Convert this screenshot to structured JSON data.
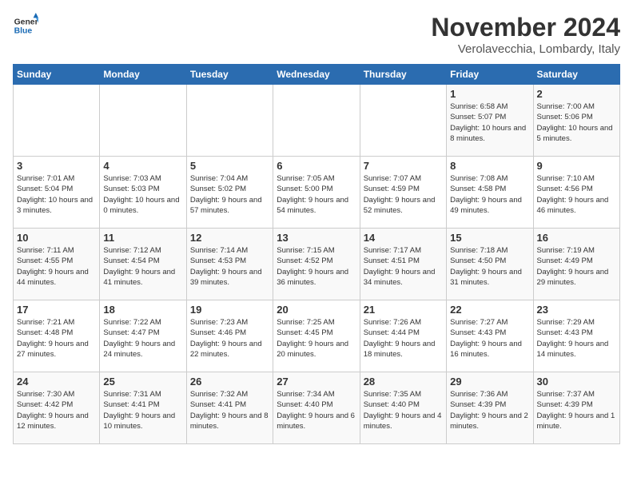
{
  "logo": {
    "general": "General",
    "blue": "Blue"
  },
  "title": "November 2024",
  "subtitle": "Verolavecchia, Lombardy, Italy",
  "headers": [
    "Sunday",
    "Monday",
    "Tuesday",
    "Wednesday",
    "Thursday",
    "Friday",
    "Saturday"
  ],
  "weeks": [
    [
      {
        "day": "",
        "info": ""
      },
      {
        "day": "",
        "info": ""
      },
      {
        "day": "",
        "info": ""
      },
      {
        "day": "",
        "info": ""
      },
      {
        "day": "",
        "info": ""
      },
      {
        "day": "1",
        "info": "Sunrise: 6:58 AM\nSunset: 5:07 PM\nDaylight: 10 hours and 8 minutes."
      },
      {
        "day": "2",
        "info": "Sunrise: 7:00 AM\nSunset: 5:06 PM\nDaylight: 10 hours and 5 minutes."
      }
    ],
    [
      {
        "day": "3",
        "info": "Sunrise: 7:01 AM\nSunset: 5:04 PM\nDaylight: 10 hours and 3 minutes."
      },
      {
        "day": "4",
        "info": "Sunrise: 7:03 AM\nSunset: 5:03 PM\nDaylight: 10 hours and 0 minutes."
      },
      {
        "day": "5",
        "info": "Sunrise: 7:04 AM\nSunset: 5:02 PM\nDaylight: 9 hours and 57 minutes."
      },
      {
        "day": "6",
        "info": "Sunrise: 7:05 AM\nSunset: 5:00 PM\nDaylight: 9 hours and 54 minutes."
      },
      {
        "day": "7",
        "info": "Sunrise: 7:07 AM\nSunset: 4:59 PM\nDaylight: 9 hours and 52 minutes."
      },
      {
        "day": "8",
        "info": "Sunrise: 7:08 AM\nSunset: 4:58 PM\nDaylight: 9 hours and 49 minutes."
      },
      {
        "day": "9",
        "info": "Sunrise: 7:10 AM\nSunset: 4:56 PM\nDaylight: 9 hours and 46 minutes."
      }
    ],
    [
      {
        "day": "10",
        "info": "Sunrise: 7:11 AM\nSunset: 4:55 PM\nDaylight: 9 hours and 44 minutes."
      },
      {
        "day": "11",
        "info": "Sunrise: 7:12 AM\nSunset: 4:54 PM\nDaylight: 9 hours and 41 minutes."
      },
      {
        "day": "12",
        "info": "Sunrise: 7:14 AM\nSunset: 4:53 PM\nDaylight: 9 hours and 39 minutes."
      },
      {
        "day": "13",
        "info": "Sunrise: 7:15 AM\nSunset: 4:52 PM\nDaylight: 9 hours and 36 minutes."
      },
      {
        "day": "14",
        "info": "Sunrise: 7:17 AM\nSunset: 4:51 PM\nDaylight: 9 hours and 34 minutes."
      },
      {
        "day": "15",
        "info": "Sunrise: 7:18 AM\nSunset: 4:50 PM\nDaylight: 9 hours and 31 minutes."
      },
      {
        "day": "16",
        "info": "Sunrise: 7:19 AM\nSunset: 4:49 PM\nDaylight: 9 hours and 29 minutes."
      }
    ],
    [
      {
        "day": "17",
        "info": "Sunrise: 7:21 AM\nSunset: 4:48 PM\nDaylight: 9 hours and 27 minutes."
      },
      {
        "day": "18",
        "info": "Sunrise: 7:22 AM\nSunset: 4:47 PM\nDaylight: 9 hours and 24 minutes."
      },
      {
        "day": "19",
        "info": "Sunrise: 7:23 AM\nSunset: 4:46 PM\nDaylight: 9 hours and 22 minutes."
      },
      {
        "day": "20",
        "info": "Sunrise: 7:25 AM\nSunset: 4:45 PM\nDaylight: 9 hours and 20 minutes."
      },
      {
        "day": "21",
        "info": "Sunrise: 7:26 AM\nSunset: 4:44 PM\nDaylight: 9 hours and 18 minutes."
      },
      {
        "day": "22",
        "info": "Sunrise: 7:27 AM\nSunset: 4:43 PM\nDaylight: 9 hours and 16 minutes."
      },
      {
        "day": "23",
        "info": "Sunrise: 7:29 AM\nSunset: 4:43 PM\nDaylight: 9 hours and 14 minutes."
      }
    ],
    [
      {
        "day": "24",
        "info": "Sunrise: 7:30 AM\nSunset: 4:42 PM\nDaylight: 9 hours and 12 minutes."
      },
      {
        "day": "25",
        "info": "Sunrise: 7:31 AM\nSunset: 4:41 PM\nDaylight: 9 hours and 10 minutes."
      },
      {
        "day": "26",
        "info": "Sunrise: 7:32 AM\nSunset: 4:41 PM\nDaylight: 9 hours and 8 minutes."
      },
      {
        "day": "27",
        "info": "Sunrise: 7:34 AM\nSunset: 4:40 PM\nDaylight: 9 hours and 6 minutes."
      },
      {
        "day": "28",
        "info": "Sunrise: 7:35 AM\nSunset: 4:40 PM\nDaylight: 9 hours and 4 minutes."
      },
      {
        "day": "29",
        "info": "Sunrise: 7:36 AM\nSunset: 4:39 PM\nDaylight: 9 hours and 2 minutes."
      },
      {
        "day": "30",
        "info": "Sunrise: 7:37 AM\nSunset: 4:39 PM\nDaylight: 9 hours and 1 minute."
      }
    ]
  ]
}
